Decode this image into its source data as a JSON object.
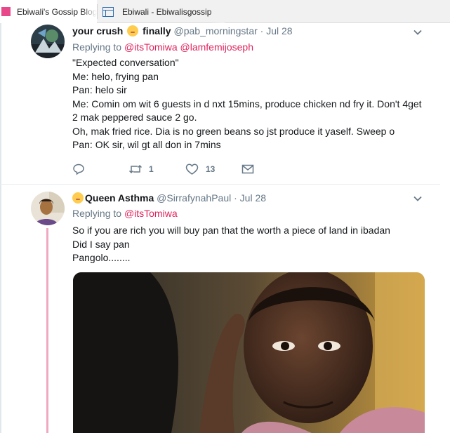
{
  "tabs": [
    {
      "title": "Ebiwali's Gossip Blog"
    },
    {
      "title": "Ebiwali - Ebiwalisgossip"
    }
  ],
  "tweets": [
    {
      "name_part1": "your crush",
      "name_part2": "finally",
      "handle": "@pab_morningstar",
      "separator": "·",
      "date": "Jul 28",
      "replying_label": "Replying to",
      "mentions": [
        "@itsTomiwa",
        "@lamfemijoseph"
      ],
      "lines": [
        "\"Expected conversation\"",
        "Me: helo, frying pan",
        "Pan: helo sir",
        "Me: Comin om wit 6 guests in d nxt 15mins, produce chicken nd fry it. Don't 4get",
        "2 mak peppered sauce 2 go.",
        "Oh, mak fried rice. Dia is no green beans so jst produce it yaself. Sweep o",
        "Pan: OK sir, wil gt all don in 7mins"
      ],
      "retweets": "1",
      "likes": "13"
    },
    {
      "name": "Queen Asthma",
      "handle": "@SirrafynahPaul",
      "separator": "·",
      "date": "Jul 28",
      "replying_label": "Replying to",
      "mentions": [
        "@itsTomiwa"
      ],
      "lines": [
        "So if you are rich you will buy pan that the worth a piece of land in ibadan",
        "Did I say pan",
        "Pangolo........"
      ]
    }
  ],
  "icons": {
    "reply": "reply-icon",
    "retweet": "retweet-icon",
    "like": "heart-icon",
    "dm": "envelope-icon",
    "more": "chevron-down-icon"
  },
  "colors": {
    "mention": "#e0245e",
    "muted": "#657786",
    "thread": "#f0a7c0",
    "tab_favicon": "#e8488a"
  }
}
